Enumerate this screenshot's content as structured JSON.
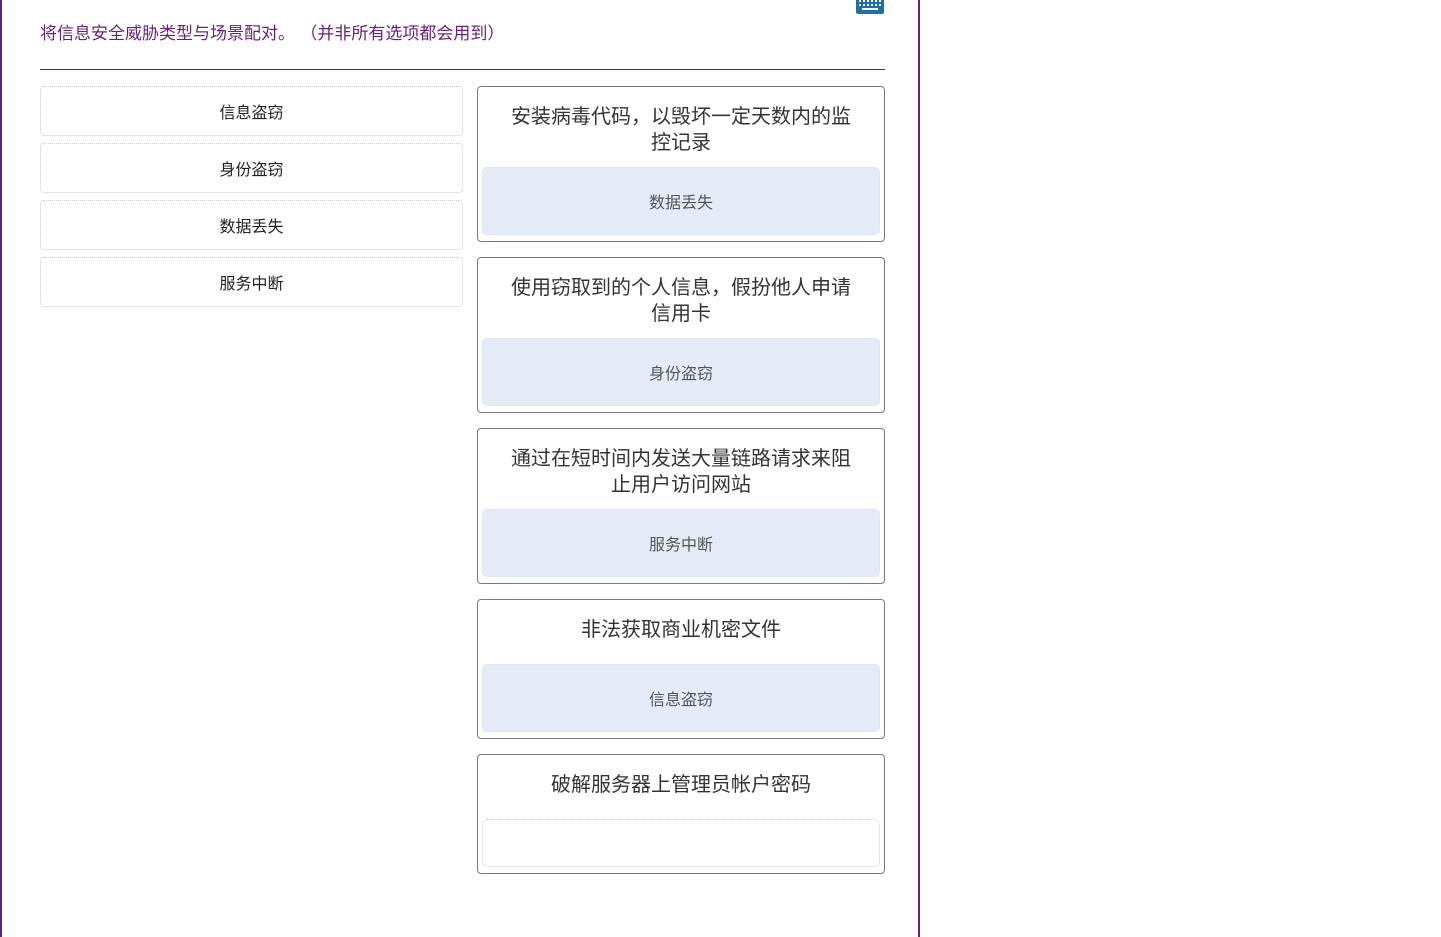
{
  "instruction": "将信息安全威胁类型与场景配对。 （并非所有选项都会用到）",
  "options": [
    {
      "label": "信息盗窃"
    },
    {
      "label": "身份盗窃"
    },
    {
      "label": "数据丢失"
    },
    {
      "label": "服务中断"
    }
  ],
  "targets": [
    {
      "scenario": "安装病毒代码，以毁坏一定天数内的监控记录",
      "answer": "数据丢失"
    },
    {
      "scenario": "使用窃取到的个人信息，假扮他人申请信用卡",
      "answer": "身份盗窃"
    },
    {
      "scenario": "通过在短时间内发送大量链路请求来阻止用户访问网站",
      "answer": "服务中断"
    },
    {
      "scenario": "非法获取商业机密文件",
      "answer": "信息盗窃"
    },
    {
      "scenario": "破解服务器上管理员帐户密码",
      "answer": ""
    }
  ],
  "colors": {
    "accent": "#6b1f7c",
    "dropzone_filled": "#e4ebf7",
    "keyboard_icon": "#1f6fa0"
  },
  "icons": {
    "keyboard": "keyboard-icon"
  }
}
